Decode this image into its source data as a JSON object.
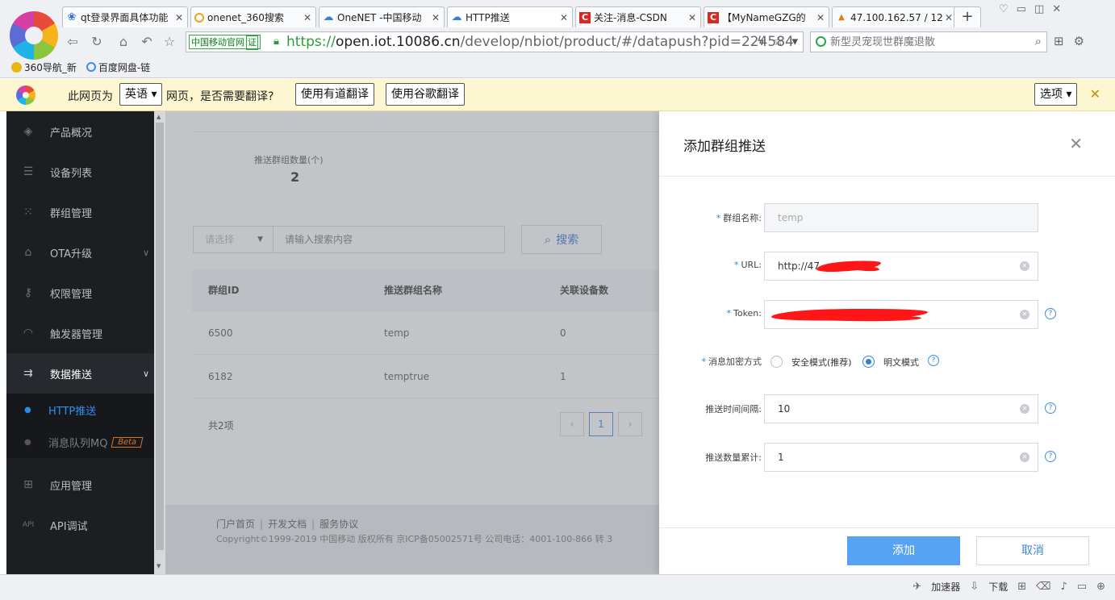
{
  "browser": {
    "tabs": [
      {
        "title": "qt登录界面具体功能",
        "favicon": "paw-icon",
        "active": false
      },
      {
        "title": "onenet_360搜索",
        "favicon": "360-ring-icon",
        "active": false
      },
      {
        "title": "OneNET -中国移动",
        "favicon": "cloud-icon",
        "active": false
      },
      {
        "title": "HTTP推送",
        "favicon": "cloud-icon",
        "active": true
      },
      {
        "title": "关注-消息-CSDN",
        "favicon": "csdn-icon",
        "active": false
      },
      {
        "title": "【MyNameGZG的",
        "favicon": "csdn-icon",
        "active": false
      },
      {
        "title": "47.100.162.57 / 12",
        "favicon": "phpmyadmin-icon",
        "active": false
      }
    ],
    "cert_badge": "中国移动官网",
    "cert_mark": "证",
    "url_scheme": "https://",
    "url_host": "open.iot.10086.cn",
    "url_path": "/develop/nbiot/product/#/datapush?pid=224584",
    "search_placeholder": "新型灵宠现世群魔退散",
    "bookmarks": [
      "360导航_新",
      "百度网盘-链"
    ]
  },
  "translate_bar": {
    "prefix": "此网页为",
    "language": "英语",
    "suffix": "网页，是否需要翻译?",
    "youdao_button": "使用有道翻译",
    "google_button": "使用谷歌翻译",
    "options_button": "选项"
  },
  "sidebar": {
    "items": [
      {
        "label": "产品概况",
        "icon": "cube-icon"
      },
      {
        "label": "设备列表",
        "icon": "list-icon"
      },
      {
        "label": "群组管理",
        "icon": "grid-dots-icon"
      },
      {
        "label": "OTA升级",
        "icon": "upload-icon"
      },
      {
        "label": "权限管理",
        "icon": "key-icon"
      },
      {
        "label": "触发器管理",
        "icon": "trigger-icon"
      },
      {
        "label": "数据推送",
        "icon": "push-icon"
      },
      {
        "label": "应用管理",
        "icon": "apps-icon"
      },
      {
        "label": "API调试",
        "icon": "api-icon"
      }
    ],
    "sub_items": [
      {
        "label": "HTTP推送",
        "active": true
      },
      {
        "label": "消息队列MQ",
        "badge": "Beta",
        "active": false
      }
    ]
  },
  "content": {
    "stat_label": "推送群组数量(个)",
    "stat_value": "2",
    "filter_select": "请选择",
    "filter_placeholder": "请输入搜索内容",
    "search_button": "搜索",
    "table": {
      "headers": [
        "群组ID",
        "推送群组名称",
        "关联设备数"
      ],
      "rows": [
        [
          "6500",
          "temp",
          "0"
        ],
        [
          "6182",
          "temptrue",
          "1"
        ]
      ]
    },
    "total": "共2项",
    "current_page": "1",
    "pager_trail": "",
    "footer_links": [
      "门户首页",
      "开发文档",
      "服务协议"
    ],
    "copyright": "Copyright©1999-2019 中国移动 版权所有 京ICP备05002571号 公司电话：4001-100-866 转 3"
  },
  "drawer": {
    "title": "添加群组推送",
    "fields": {
      "name_label": "群组名称:",
      "name_value": "temp",
      "url_label": "URL:",
      "url_value": "http://47.",
      "token_label": "Token:",
      "encrypt_label": "消息加密方式",
      "encrypt_options": [
        "安全模式(推荐)",
        "明文模式"
      ],
      "encrypt_selected": "明文模式",
      "interval_label": "推送时间间隔:",
      "interval_value": "10",
      "count_label": "推送数量累计:",
      "count_value": "1"
    },
    "add_button": "添加",
    "cancel_button": "取消"
  },
  "statusbar": {
    "accelerator": "加速器",
    "download": "下载"
  },
  "colors": {
    "primary": "#2d7fe3",
    "sidebar_bg": "#1c1f22",
    "redaction": "#ff1616"
  }
}
